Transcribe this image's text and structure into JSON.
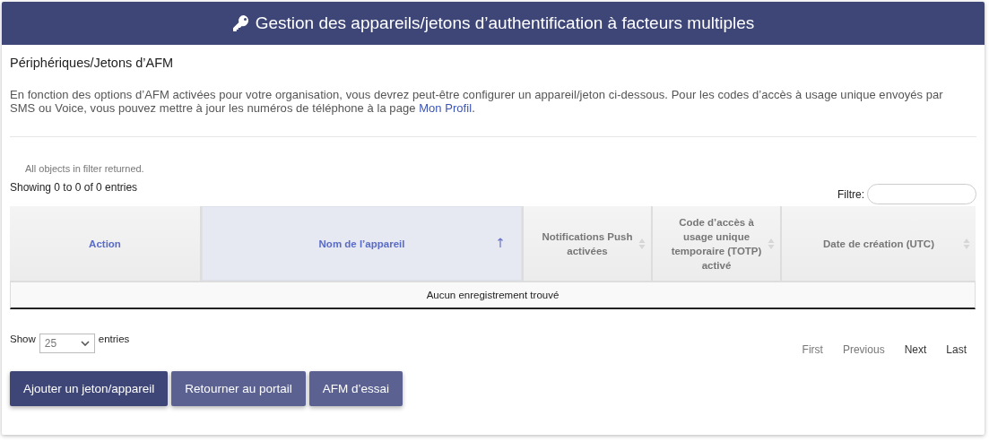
{
  "header": {
    "title": "Gestion des appareils/jetons d’authentification à facteurs multiples"
  },
  "section_title": "Périphériques/Jetons d’AFM",
  "intro": {
    "text": "En fonction des options d’AFM activées pour votre organisation, vous devrez peut-être configurer un appareil/jeton ci-dessous. Pour les codes d’accès à usage unique envoyés par SMS ou Voice, vous pouvez mettre à jour les numéros de téléphone à la page ",
    "link": "Mon Profil",
    "end": "."
  },
  "filter_note": "All objects in filter returned.",
  "info": "Showing 0 to 0 of 0 entries",
  "filter": {
    "label": "Filtre:"
  },
  "table": {
    "columns": [
      {
        "label": "Action",
        "kind": "plain",
        "selected": false
      },
      {
        "label": "Nom de l’appareil",
        "kind": "sorted",
        "selected": true
      },
      {
        "label": "Notifications Push activées",
        "kind": "sortable",
        "selected": false
      },
      {
        "label": "Code d’accès à usage unique temporaire (TOTP) activé",
        "kind": "sortable",
        "selected": false
      },
      {
        "label": "Date de création (UTC)",
        "kind": "sortable",
        "selected": false
      }
    ],
    "empty": "Aucun enregistrement trouvé"
  },
  "length": {
    "label": "Show",
    "value": "25",
    "suffix": "entries"
  },
  "pagination": [
    {
      "label": "First",
      "disabled": true
    },
    {
      "label": "Previous",
      "disabled": true
    },
    {
      "label": "Next",
      "disabled": false
    },
    {
      "label": "Last",
      "disabled": false
    }
  ],
  "buttons": [
    {
      "label": "Ajouter un jeton/appareil",
      "kind": "primary"
    },
    {
      "label": "Retourner au portail",
      "kind": "secondary"
    },
    {
      "label": "AFM d’essai",
      "kind": "secondary"
    }
  ]
}
